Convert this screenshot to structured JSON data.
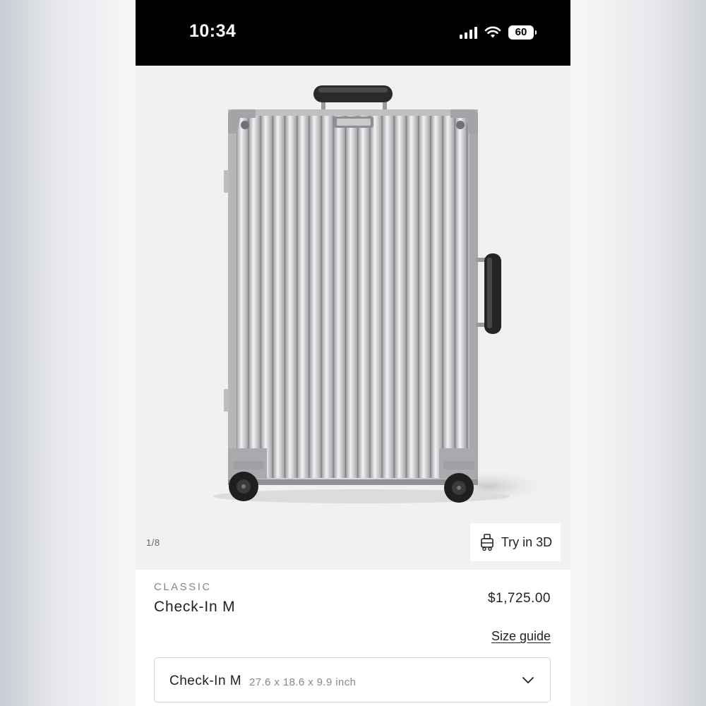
{
  "status_bar": {
    "time": "10:34",
    "battery": "60"
  },
  "gallery": {
    "image_alt": "Silver aluminium suitcase",
    "counter": "1/8",
    "try_3d_label": "Try in 3D"
  },
  "product": {
    "collection": "CLASSIC",
    "name": "Check-In M",
    "price": "$1,725.00",
    "size_guide_label": "Size guide"
  },
  "size_selector": {
    "selected_name": "Check-In M",
    "selected_dimensions": "27.6 x 18.6 x 9.9 inch"
  },
  "colors": {
    "status_bar_bg": "#000000",
    "gallery_bg": "#f1f1f0",
    "text_primary": "#222222",
    "text_muted": "#888888"
  }
}
